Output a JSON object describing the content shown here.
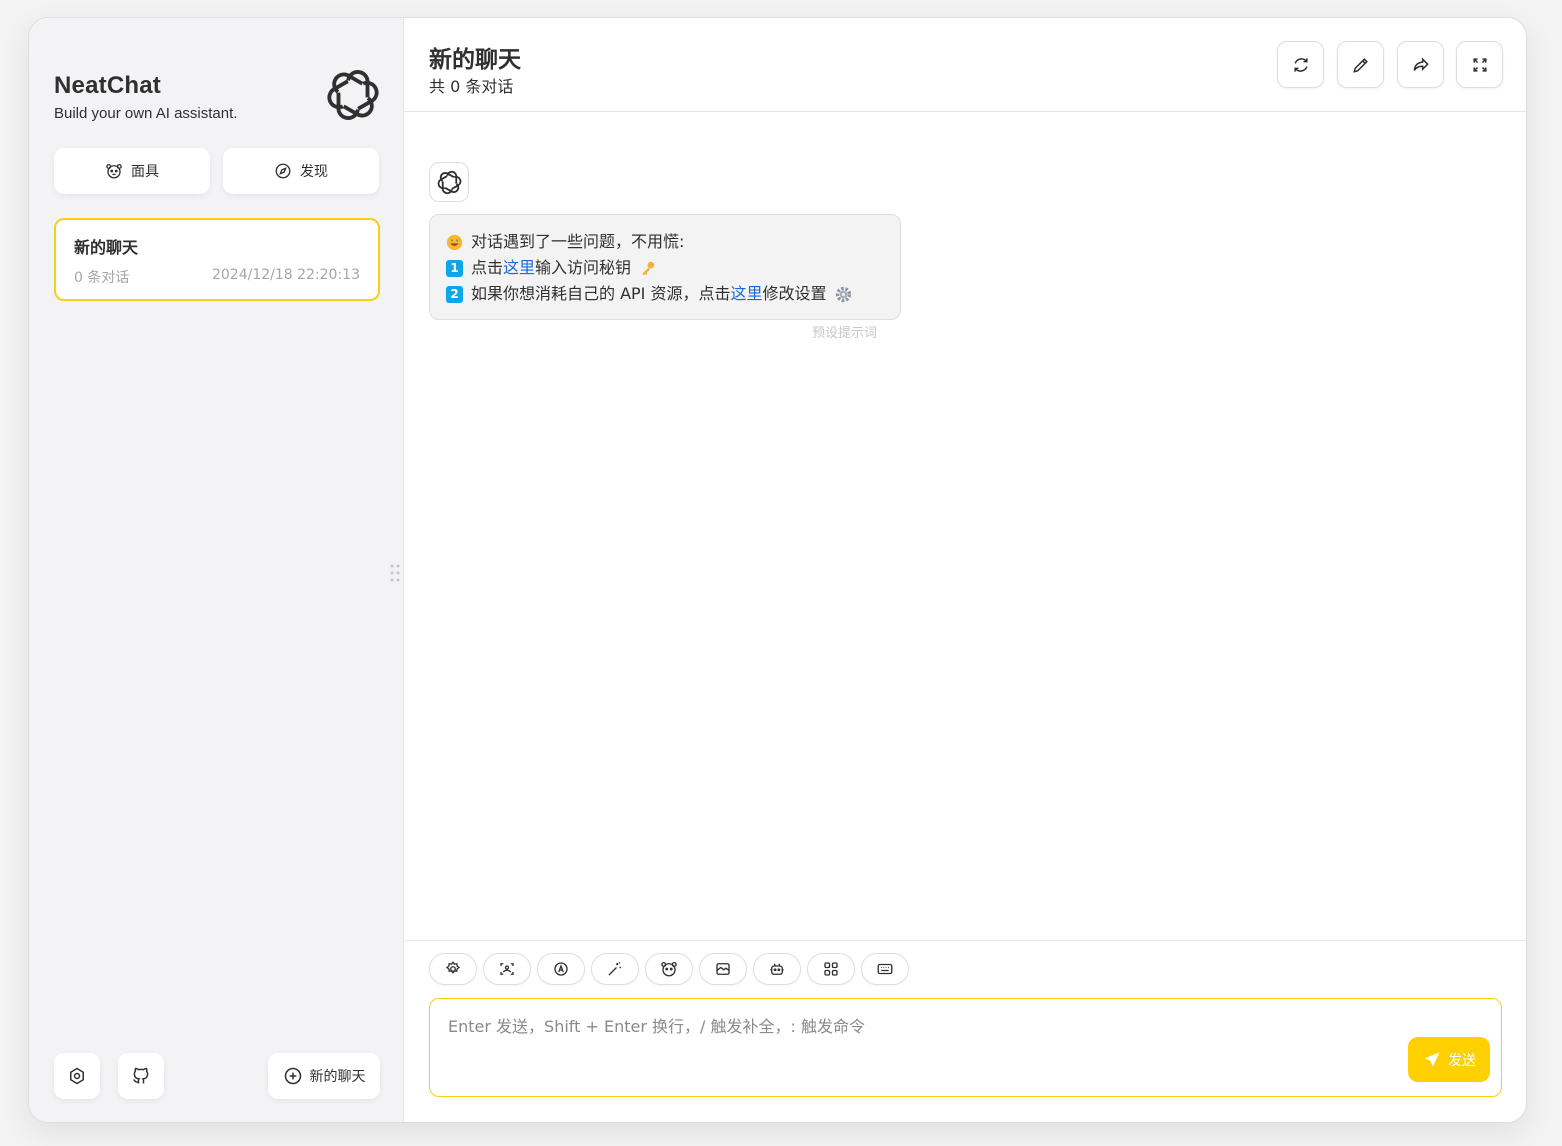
{
  "brand": {
    "title": "NeatChat",
    "subtitle": "Build your own AI assistant.",
    "logo_icon": "openai-logo-icon"
  },
  "sidebar": {
    "mask_label": "面具",
    "discover_label": "发现",
    "chats": [
      {
        "title": "新的聊天",
        "count": "0 条对话",
        "time": "2024/12/18 22:20:13",
        "selected": true
      }
    ],
    "footer": {
      "settings_icon": "settings-icon",
      "github_icon": "github-icon",
      "new_chat_label": "新的聊天"
    }
  },
  "header": {
    "title": "新的聊天",
    "subtitle": "共 0 条对话",
    "actions": [
      "refresh-icon",
      "edit-icon",
      "share-icon",
      "fullscreen-icon"
    ]
  },
  "message": {
    "line1": "对话遇到了一些问题，不用慌:",
    "line2_prefix": "点击",
    "line2_link": "这里",
    "line2_suffix": "输入访问秘钥",
    "line3_prefix": "如果你想消耗自己的 API 资源，点击",
    "line3_link": "这里",
    "line3_suffix": "修改设置",
    "badge1": "1",
    "badge2": "2",
    "note": "预设提示词"
  },
  "input": {
    "placeholder": "Enter 发送，Shift + Enter 换行，/ 触发补全，: 触发命令",
    "send_label": "发送"
  },
  "colors": {
    "accent": "#f5cf1b",
    "send_button": "#ffd000",
    "link": "#1a6ad8"
  }
}
